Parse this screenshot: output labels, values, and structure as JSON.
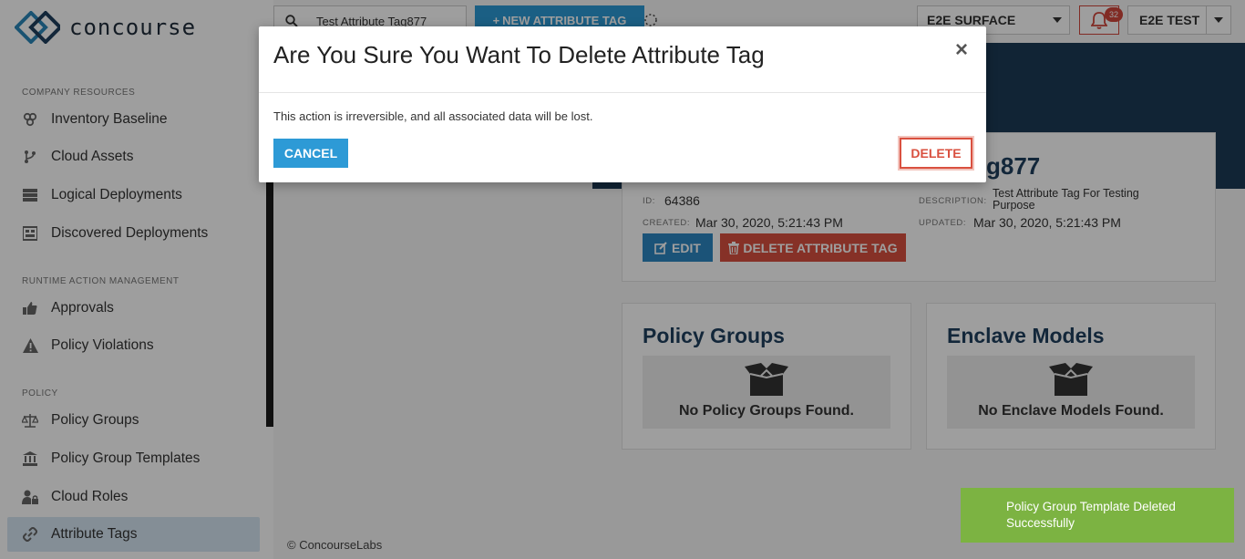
{
  "app": {
    "logo_text": "concourse"
  },
  "sidebar": {
    "sections": [
      {
        "label": "COMPANY RESOURCES"
      },
      {
        "label": "RUNTIME ACTION MANAGEMENT"
      },
      {
        "label": "POLICY"
      }
    ],
    "items": [
      {
        "label": "Inventory Baseline",
        "icon": "inventory-icon"
      },
      {
        "label": "Cloud Assets",
        "icon": "branch-icon"
      },
      {
        "label": "Logical Deployments",
        "icon": "server-icon"
      },
      {
        "label": "Discovered Deployments",
        "icon": "discovered-icon"
      },
      {
        "label": "Approvals",
        "icon": "thumbs-up-icon"
      },
      {
        "label": "Policy Violations",
        "icon": "warning-icon"
      },
      {
        "label": "Policy Groups",
        "icon": "balance-scale-icon"
      },
      {
        "label": "Policy Group Templates",
        "icon": "bank-icon"
      },
      {
        "label": "Cloud Roles",
        "icon": "user-lock-icon"
      },
      {
        "label": "Attribute Tags",
        "icon": "link-icon",
        "active": true
      }
    ]
  },
  "topbar": {
    "search_value": "Test Attribute Tag877",
    "new_button_label": "NEW ATTRIBUTE TAG",
    "org_select": "E2E SURFACE",
    "notification_count": "32",
    "user_select": "E2E TEST"
  },
  "tag": {
    "title": "g877",
    "id_label": "ID:",
    "id_value": "64386",
    "created_label": "CREATED:",
    "created_value": "Mar 30, 2020, 5:21:43 PM",
    "description_label": "DESCRIPTION:",
    "description_value": "Test Attribute Tag For Testing Purpose",
    "updated_label": "UPDATED:",
    "updated_value": "Mar 30, 2020, 5:21:43 PM",
    "edit_label": "EDIT",
    "delete_label": "DELETE ATTRIBUTE TAG"
  },
  "policy_groups": {
    "title": "Policy Groups",
    "empty_message": "No Policy Groups Found."
  },
  "enclave_models": {
    "title": "Enclave Models",
    "empty_message": "No Enclave Models Found."
  },
  "footer": {
    "text": "© ConcourseLabs"
  },
  "modal": {
    "title": "Are You Sure You Want To Delete Attribute Tag",
    "close_glyph": "×",
    "body": "This action is irreversible, and all associated data will be lost.",
    "cancel_label": "CANCEL",
    "delete_label": "DELETE"
  },
  "toast": {
    "message": "Policy Group Template Deleted Successfully"
  },
  "colors": {
    "primary": "#2d9ad6",
    "danger": "#d9503f",
    "success": "#7cb342",
    "header_navy": "#1c3a56",
    "active_nav": "#d6e6f3"
  }
}
